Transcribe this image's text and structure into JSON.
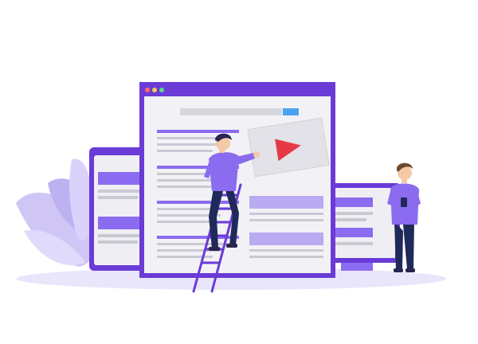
{
  "colors": {
    "primary": "#6a3bd6",
    "primary_light": "#8b6cf0",
    "lavender": "#b9aaf2",
    "lavender_soft": "#dcd4fb",
    "ground": "#e9e5fb",
    "gray_panel": "#efeff3",
    "gray_bar": "#c9c9d3",
    "play_red": "#e63946",
    "navy": "#1f2a5a",
    "skin": "#f3c9a6",
    "hair": "#2a2450",
    "search_button": "#4aa3f0"
  },
  "window_controls": [
    "red-dot",
    "yellow-dot",
    "green-dot"
  ],
  "icons": {
    "play": "play-icon",
    "ladder": "ladder-icon"
  }
}
